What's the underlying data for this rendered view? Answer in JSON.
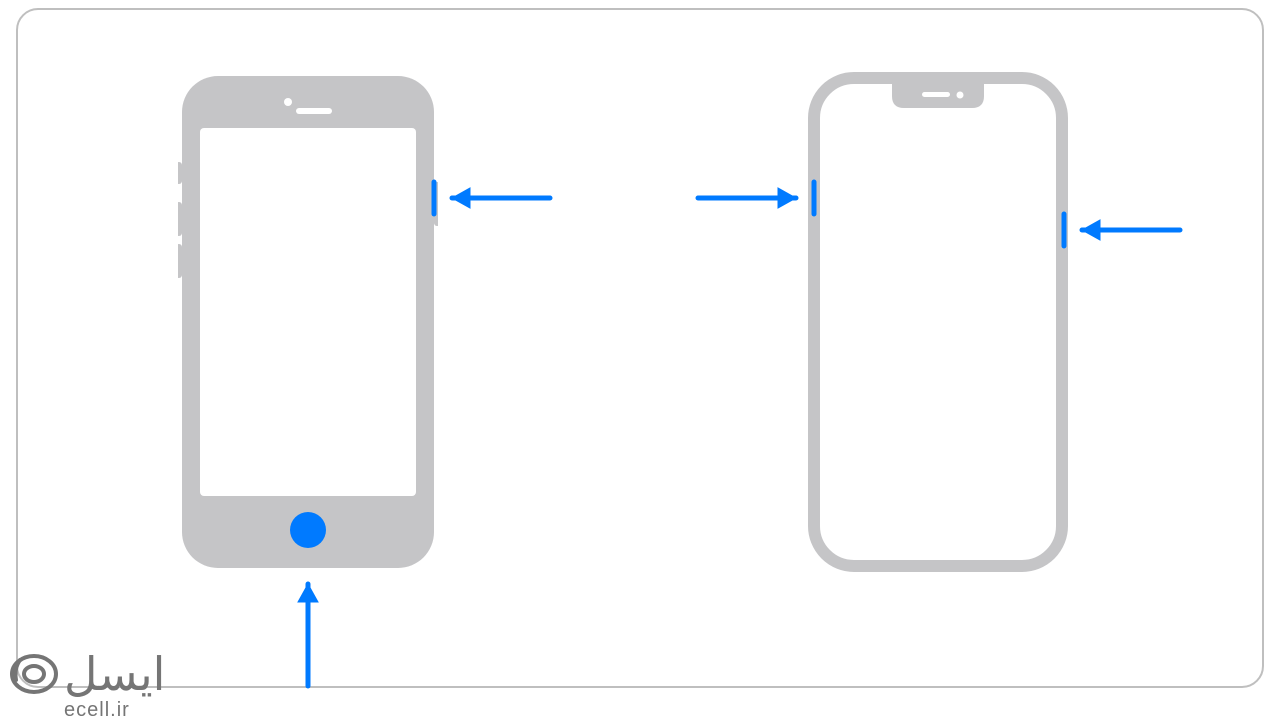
{
  "logo": {
    "brand_text": "ایسل",
    "url_text": "ecell.ir"
  },
  "colors": {
    "accent": "#007aff",
    "phone_body": "#c5c5c7",
    "frame_border": "#bfbfbf"
  },
  "diagram": {
    "left_phone": {
      "model": "iphone-with-home-button",
      "highlighted_home_button": true,
      "arrows": [
        "side-button-right",
        "home-button-bottom"
      ]
    },
    "right_phone": {
      "model": "iphone-face-id",
      "arrows": [
        "volume-button-left",
        "side-button-right"
      ]
    }
  }
}
